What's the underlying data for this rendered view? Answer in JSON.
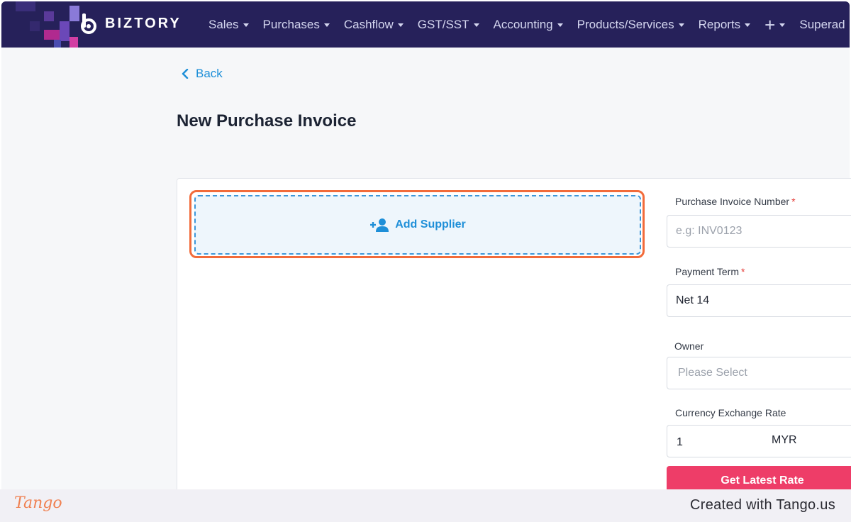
{
  "app": {
    "brand": "BIZTORY"
  },
  "nav": {
    "items": [
      {
        "label": "Sales"
      },
      {
        "label": "Purchases"
      },
      {
        "label": "Cashflow"
      },
      {
        "label": "GST/SST"
      },
      {
        "label": "Accounting"
      },
      {
        "label": "Products/Services"
      },
      {
        "label": "Reports"
      }
    ],
    "plus": "+",
    "overflow": "Superad"
  },
  "back": {
    "label": "Back"
  },
  "page": {
    "title": "New Purchase Invoice"
  },
  "supplier": {
    "add_label": "Add Supplier"
  },
  "form": {
    "invoice_number": {
      "label": "Purchase Invoice Number",
      "required_mark": "*",
      "placeholder": "e.g: INV0123",
      "value": ""
    },
    "payment_term": {
      "label": "Payment Term",
      "required_mark": "*",
      "value": "Net 14"
    },
    "owner": {
      "label": "Owner",
      "placeholder": "Please Select"
    },
    "exchange_rate": {
      "label": "Currency Exchange Rate",
      "value": "1",
      "currency": "MYR"
    },
    "get_rate_button": "Get Latest Rate"
  },
  "footer": {
    "logo_text": "Tango",
    "credit": "Created with Tango.us"
  },
  "colors": {
    "nav_bg": "#26215a",
    "accent_blue": "#1e8fd8",
    "highlight": "#f26b3a",
    "rate_button": "#ee3d68"
  }
}
